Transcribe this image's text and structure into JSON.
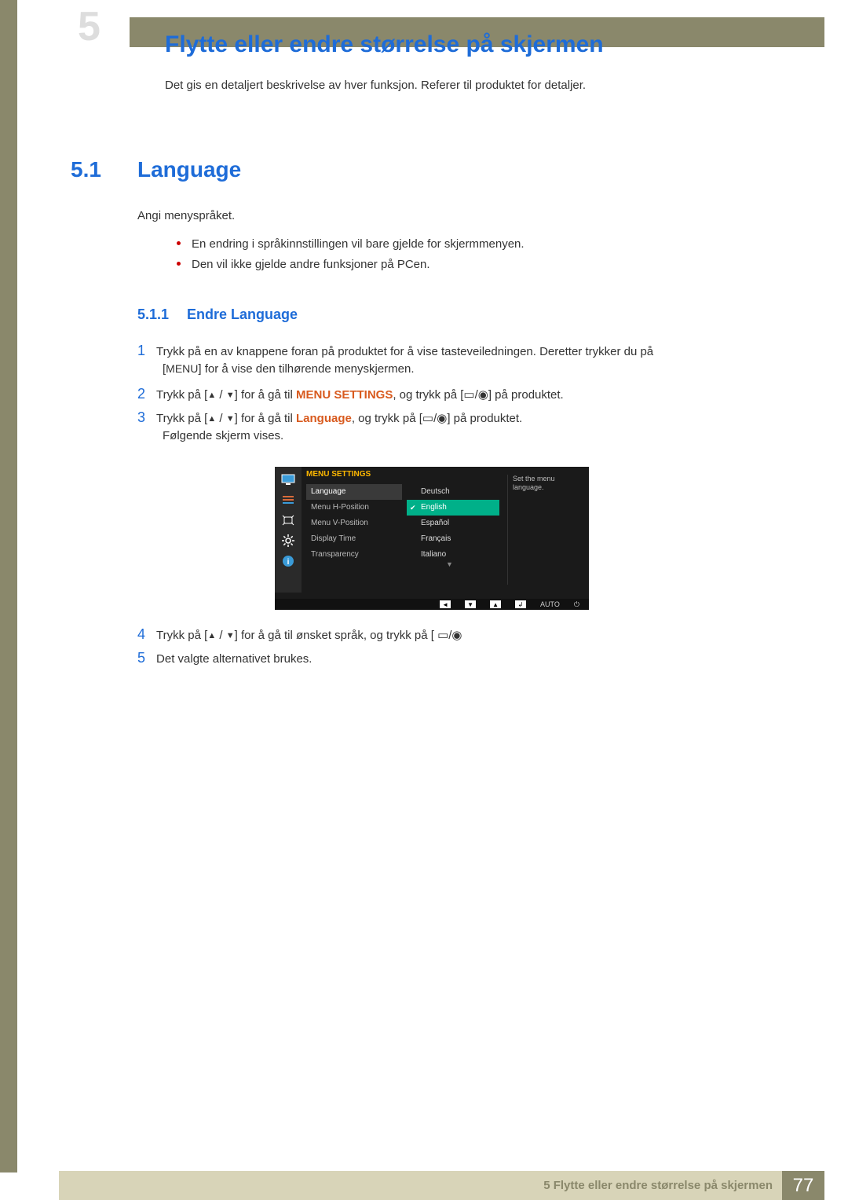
{
  "chapter_number": "5",
  "page_title": "Flytte eller endre størrelse på skjermen",
  "intro": "Det gis en detaljert beskrivelse av hver funksjon. Referer til produktet for detaljer.",
  "section": {
    "number": "5.1",
    "title": "Language",
    "lead": "Angi menyspråket.",
    "notes": [
      "En endring i språkinnstillingen vil bare gjelde for skjermmenyen.",
      "Den vil ikke gjelde andre funksjoner på PCen."
    ]
  },
  "subsection": {
    "number": "5.1.1",
    "title": "Endre Language"
  },
  "steps": {
    "s1a": "Trykk på en av knappene foran på produktet for å vise tasteveiledningen. Deretter trykker du på",
    "s1b": "] for å vise den tilhørende menyskjermen.",
    "s1_menu": "MENU",
    "s2a": "Trykk på [",
    "s2b": "] for å gå til ",
    "s2_hl": "MENU SETTINGS",
    "s2c": ", og trykk på [",
    "s2d": "] på produktet.",
    "s3a": "Trykk på [",
    "s3b": "] for å gå til ",
    "s3_hl": "Language",
    "s3c": ", og trykk på [",
    "s3d": "] på produktet.",
    "s3e": "Følgende skjerm vises.",
    "s4a": "Trykk på [",
    "s4b": "] for å gå til ønsket språk, og trykk på [",
    "s4c": "",
    "s5": "Det valgte alternativet brukes."
  },
  "osd": {
    "header": "MENU SETTINGS",
    "left_items": [
      "Language",
      "Menu H-Position",
      "Menu V-Position",
      "Display Time",
      "Transparency"
    ],
    "right_items": [
      "Deutsch",
      "English",
      "Español",
      "Français",
      "Italiano"
    ],
    "selected_left": 0,
    "selected_right": 1,
    "description": "Set the menu language.",
    "footer_auto": "AUTO"
  },
  "footer": {
    "text": "5 Flytte eller endre størrelse på skjermen",
    "page": "77"
  }
}
